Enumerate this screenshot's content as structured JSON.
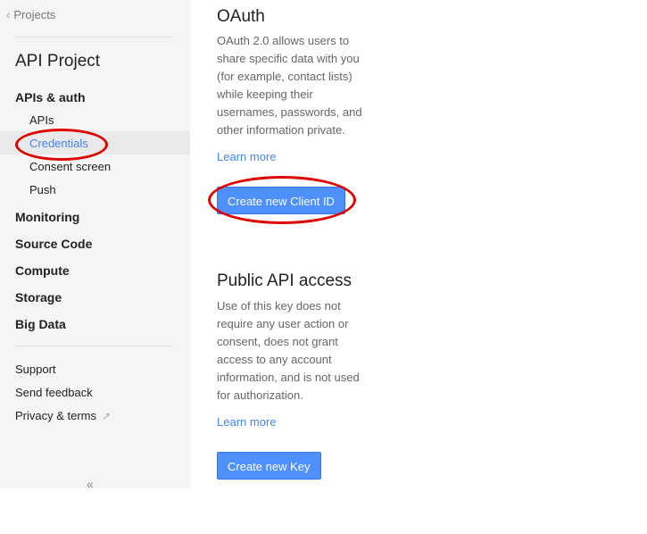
{
  "sidebar": {
    "back_label": "Projects",
    "project_title": "API Project",
    "sections": [
      {
        "label": "APIs & auth"
      },
      {
        "label": "Monitoring"
      },
      {
        "label": "Source Code"
      },
      {
        "label": "Compute"
      },
      {
        "label": "Storage"
      },
      {
        "label": "Big Data"
      }
    ],
    "apis_auth_items": [
      {
        "label": "APIs",
        "active": false
      },
      {
        "label": "Credentials",
        "active": true
      },
      {
        "label": "Consent screen",
        "active": false
      },
      {
        "label": "Push",
        "active": false
      }
    ],
    "footer_links": [
      {
        "label": "Support"
      },
      {
        "label": "Send feedback"
      },
      {
        "label": "Privacy & terms",
        "icon": "external-link-icon"
      }
    ],
    "collapse_label": "«"
  },
  "oauth": {
    "title": "OAuth",
    "description": "OAuth 2.0 allows users to share specific data with you (for example, contact lists) while keeping their usernames, passwords, and other information private.",
    "learn_more": "Learn more",
    "button_label": "Create new Client ID"
  },
  "public_api": {
    "title": "Public API access",
    "description": "Use of this key does not require any user action or consent, does not grant access to any account information, and is not used for authorization.",
    "learn_more": "Learn more",
    "button_label": "Create new Key"
  },
  "colors": {
    "accent": "#4285f4",
    "button": "#4d90fe",
    "annotation": "#e00000",
    "sidebar_bg": "#f5f5f5"
  }
}
